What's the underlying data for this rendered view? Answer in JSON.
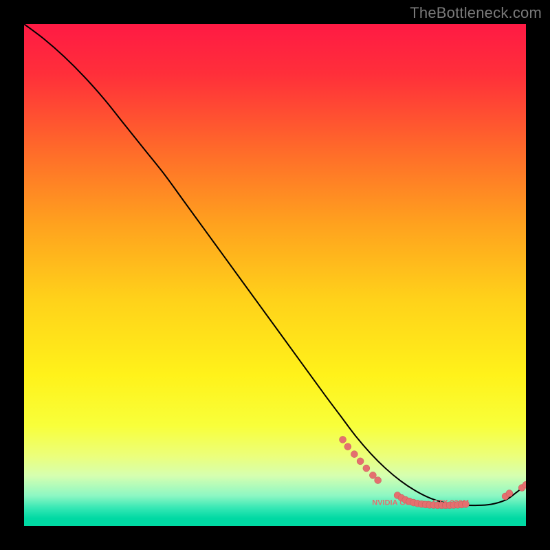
{
  "watermark": "TheBottleneck.com",
  "colors": {
    "curve": "#000000",
    "marker_fill": "#e46f6f",
    "marker_stroke": "#c45a5a",
    "label_fill": "#e46f6f",
    "frame_bg": "#000000"
  },
  "gradient_stops": [
    {
      "offset": 0.0,
      "color": "#ff1a44"
    },
    {
      "offset": 0.1,
      "color": "#ff2f3a"
    },
    {
      "offset": 0.25,
      "color": "#ff6a2a"
    },
    {
      "offset": 0.4,
      "color": "#ffa21e"
    },
    {
      "offset": 0.55,
      "color": "#ffd21a"
    },
    {
      "offset": 0.7,
      "color": "#fff21a"
    },
    {
      "offset": 0.8,
      "color": "#f8ff3a"
    },
    {
      "offset": 0.86,
      "color": "#ecff7a"
    },
    {
      "offset": 0.9,
      "color": "#d6ffb0"
    },
    {
      "offset": 0.94,
      "color": "#8cf7c3"
    },
    {
      "offset": 0.965,
      "color": "#33e7b4"
    },
    {
      "offset": 0.985,
      "color": "#00d9a3"
    },
    {
      "offset": 1.0,
      "color": "#00d9a3"
    }
  ],
  "chart_data": {
    "type": "line",
    "title": "",
    "xlabel": "",
    "ylabel": "",
    "xlim": [
      0,
      100
    ],
    "ylim": [
      0,
      100
    ],
    "grid": false,
    "legend": false,
    "label": {
      "text": "NVIDIA GeForce GTX 960M",
      "x": 79,
      "y": 4.2
    },
    "series": [
      {
        "name": "bottleneck-curve",
        "x": [
          0,
          4,
          8,
          12,
          16,
          20,
          24,
          28,
          32,
          36,
          40,
          44,
          48,
          52,
          56,
          60,
          63,
          66,
          69,
          72,
          75,
          78,
          81,
          84,
          87,
          90,
          93,
          96,
          98,
          100
        ],
        "y": [
          100,
          97,
          93.5,
          89.5,
          85,
          80,
          75,
          70,
          64.5,
          59,
          53.5,
          48,
          42.5,
          37,
          31.5,
          26,
          22,
          18,
          14.5,
          11.5,
          9,
          7,
          5.5,
          4.6,
          4.2,
          4.1,
          4.3,
          5.2,
          6.6,
          8.2
        ]
      }
    ],
    "markers": [
      {
        "x": 63.5,
        "y": 17.2
      },
      {
        "x": 64.5,
        "y": 15.8
      },
      {
        "x": 65.8,
        "y": 14.3
      },
      {
        "x": 67.0,
        "y": 12.9
      },
      {
        "x": 68.2,
        "y": 11.5
      },
      {
        "x": 69.5,
        "y": 10.1
      },
      {
        "x": 70.5,
        "y": 9.1
      },
      {
        "x": 74.4,
        "y": 6.1
      },
      {
        "x": 75.2,
        "y": 5.6
      },
      {
        "x": 76.0,
        "y": 5.2
      },
      {
        "x": 76.8,
        "y": 4.9
      },
      {
        "x": 77.6,
        "y": 4.65
      },
      {
        "x": 78.4,
        "y": 4.48
      },
      {
        "x": 79.2,
        "y": 4.35
      },
      {
        "x": 80.0,
        "y": 4.26
      },
      {
        "x": 80.8,
        "y": 4.2
      },
      {
        "x": 81.6,
        "y": 4.16
      },
      {
        "x": 82.4,
        "y": 4.13
      },
      {
        "x": 83.2,
        "y": 4.12
      },
      {
        "x": 84.0,
        "y": 4.12
      },
      {
        "x": 84.8,
        "y": 4.13
      },
      {
        "x": 85.6,
        "y": 4.16
      },
      {
        "x": 86.4,
        "y": 4.2
      },
      {
        "x": 87.2,
        "y": 4.25
      },
      {
        "x": 88.0,
        "y": 4.32
      },
      {
        "x": 95.9,
        "y": 5.9
      },
      {
        "x": 96.7,
        "y": 6.5
      },
      {
        "x": 99.2,
        "y": 7.6
      },
      {
        "x": 100.0,
        "y": 8.2
      }
    ]
  }
}
